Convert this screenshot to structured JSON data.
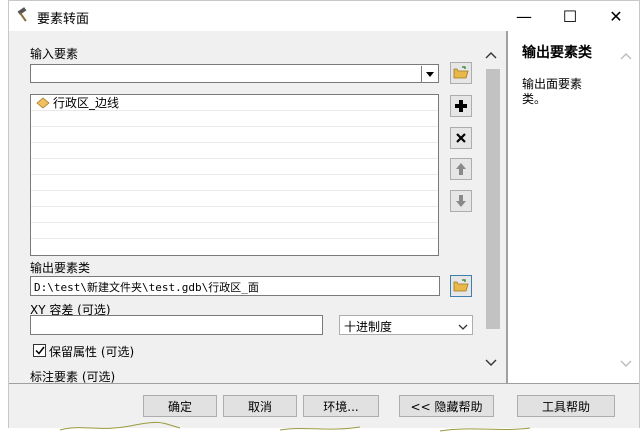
{
  "window": {
    "title": "要素转面",
    "minimize": "—",
    "maximize": "☐",
    "close": "✕"
  },
  "form": {
    "input_features_label": "输入要素",
    "input_features_value": "",
    "input_list": [
      "行政区_边线"
    ],
    "output_label": "输出要素类",
    "output_value": "D:\\test\\新建文件夹\\test.gdb\\行政区_面",
    "xy_tolerance_label": "XY 容差 (可选)",
    "xy_tolerance_value": "",
    "xy_unit": "十进制度",
    "preserve_label": "保留属性 (可选)",
    "preserve_checked": true,
    "label_features_label": "标注要素 (可选)"
  },
  "help": {
    "title": "输出要素类",
    "body": "输出面要素类。"
  },
  "buttons": {
    "ok": "确定",
    "cancel": "取消",
    "env": "环境...",
    "hide_help": "<< 隐藏帮助",
    "tool_help": "工具帮助"
  }
}
